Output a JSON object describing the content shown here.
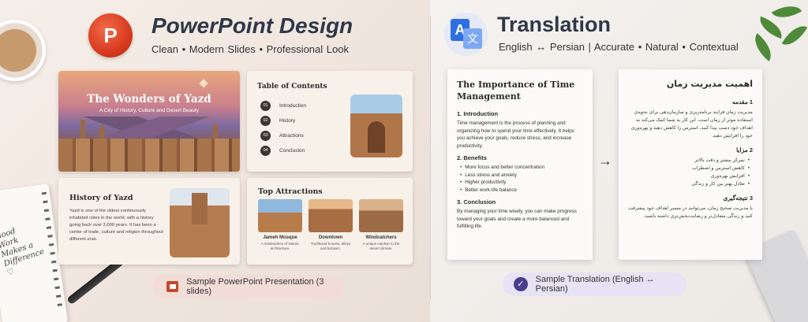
{
  "ppt": {
    "title": "PowerPoint Design",
    "subtitle": "Clean  •  Modern Slides  •  Professional Look",
    "logo_letter": "P",
    "logo_color": "#d83b1f",
    "slide1": {
      "title": "The Wonders of Yazd",
      "subtitle": "A City of History, Culture and Desert Beauty"
    },
    "slide2": {
      "title": "Table of Contents",
      "items": [
        {
          "num": "01",
          "label": "Introduction"
        },
        {
          "num": "02",
          "label": "History"
        },
        {
          "num": "03",
          "label": "Attractions"
        },
        {
          "num": "04",
          "label": "Conclusion"
        }
      ]
    },
    "slide3": {
      "title": "History of Yazd",
      "body": "Yazd is one of the oldest continuously inhabited cities in the world, with a history going back over 3,000 years. It has been a center of trade, culture and religion throughout different eras."
    },
    "slide4": {
      "title": "Top Attractions",
      "items": [
        {
          "title": "Jameh Mosque",
          "desc": "A masterpiece of Islamic architecture."
        },
        {
          "title": "Downtown",
          "desc": "Traditional houses, alleys and bazaars."
        },
        {
          "title": "Windcatchers",
          "desc": "A unique solution to the desert climate."
        }
      ]
    },
    "badge": "Sample PowerPoint Presentation (3 slides)"
  },
  "translation": {
    "title": "Translation",
    "subtitle": "English ↔ Persian   |   Accurate  •  Natural  •  Contextual",
    "logo_a": "A",
    "logo_b": "文",
    "logo_color": "#2f6fe0",
    "en": {
      "title": "The Importance of Time Management",
      "s1_heading": "1. Introduction",
      "s1_body": "Time management is the process of planning and organizing how to spend your time effectively. It helps you achieve your goals, reduce stress, and increase productivity.",
      "s2_heading": "2. Benefits",
      "s2_items": [
        "More focus and better concentration",
        "Less stress and anxiety",
        "Higher productivity",
        "Better work-life balance"
      ],
      "s3_heading": "3. Conclusion",
      "s3_body": "By managing your time wisely, you can make progress toward your goals and create a more balanced and fulfilling life."
    },
    "fa": {
      "title": "اهمیت مدیریت زمان",
      "s1_heading": "1 مقدمه",
      "s1_body": "مدیریت زمان فرایند برنامه‌ریزی و سازمان‌دهی برای نحوه‌ی استفاده موثر از زمان است. این کار به شما کمک می‌کند به اهداف خود دست پیدا کنید، استرس را کاهش دهید و بهره‌وری خود را افزایش دهید.",
      "s2_heading": "2 مزایا",
      "s2_items": [
        "تمرکز بیشتر و دقت بالاتر",
        "کاهش استرس و اضطراب",
        "افزایش بهره‌وری",
        "تعادل بهتر بین کار و زندگی"
      ],
      "s3_heading": "3 نتیجه‌گیری",
      "s3_body": "با مدیریت صحیح زمان، می‌توانید در مسیر اهداف خود پیشرفت کنید و زندگی متعادل‌تر و رضایت‌بخش‌تری داشته باشید."
    },
    "arrow": "→",
    "badge": "Sample Translation (English ↔ Persian)",
    "badge_icon": "✓"
  },
  "notebook": {
    "note": "Good Work Makes a Difference ♡"
  }
}
